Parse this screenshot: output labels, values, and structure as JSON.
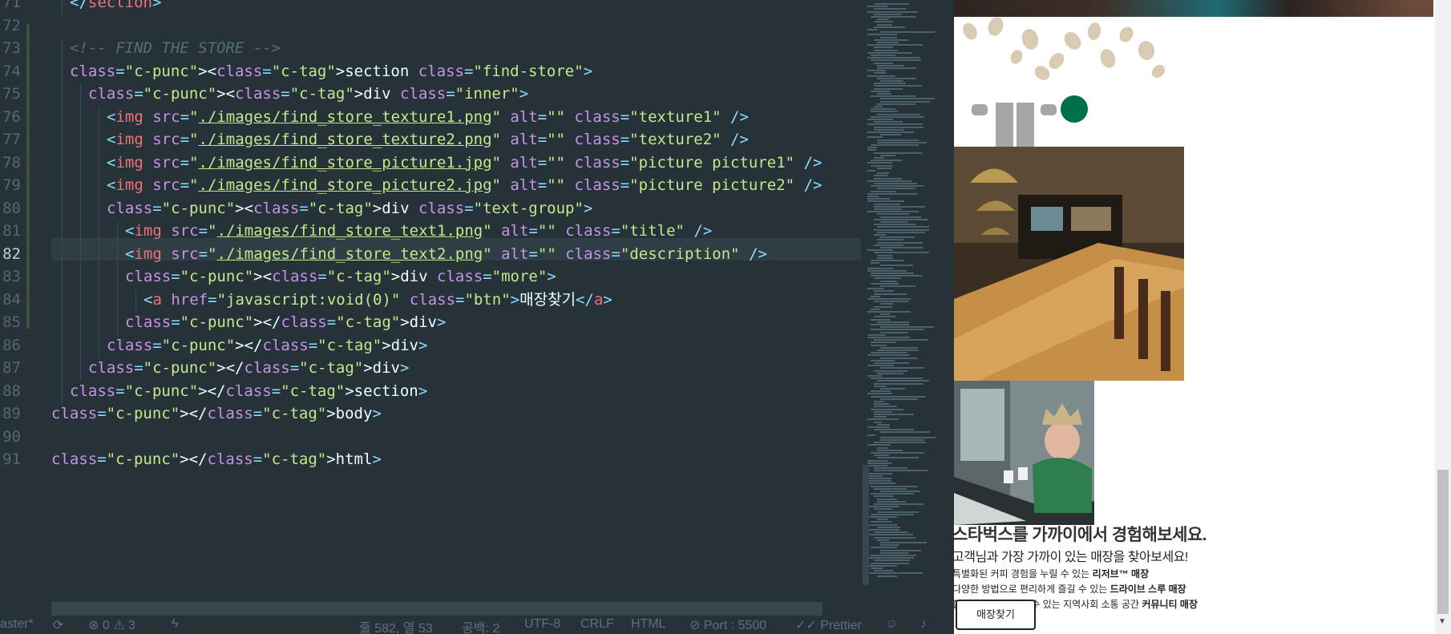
{
  "editor": {
    "line_numbers": [
      "71",
      "72",
      "73",
      "74",
      "75",
      "76",
      "77",
      "78",
      "79",
      "80",
      "81",
      "82",
      "83",
      "84",
      "85",
      "86",
      "87",
      "88",
      "89",
      "90",
      "91"
    ],
    "lines": [
      {
        "cls": "c-tag",
        "text": "</section>"
      },
      {
        "text": ""
      },
      {
        "text": "<!-- FIND THE STORE -->"
      },
      {
        "text": "<section class=\"find-store\">"
      },
      {
        "text": "<div class=\"inner\">"
      },
      {
        "path": "./images/find_store_texture1.png",
        "cls_val": "texture1"
      },
      {
        "path": "./images/find_store_texture2.png",
        "cls_val": "texture2"
      },
      {
        "path": "./images/find_store_picture1.jpg",
        "cls_val": "picture picture1"
      },
      {
        "path": "./images/find_store_picture2.jpg",
        "cls_val": "picture picture2"
      },
      {
        "text": "<div class=\"text-group\">"
      },
      {
        "path": "./images/find_store_text1.png",
        "cls_val": "title"
      },
      {
        "path": "./images/find_store_text2.png",
        "cls_val": "description"
      },
      {
        "text": "<div class=\"more\">"
      },
      {
        "href": "javascript:void(0)",
        "btn_cls": "btn",
        "label": "매장찾기"
      },
      {
        "text": "</div>"
      },
      {
        "text": "</div>"
      },
      {
        "text": "</div>"
      },
      {
        "text": "</section>"
      },
      {
        "text": "</body>"
      },
      {
        "text": ""
      },
      {
        "text": "</html>"
      }
    ],
    "statusbar": {
      "branch": "aster*",
      "errors": "0",
      "warnings": "3",
      "cursor": "줄 582, 열 53",
      "indent": "공백: 2",
      "encoding": "UTF-8",
      "eol": "CRLF",
      "language": "HTML",
      "port": "Port : 5500",
      "formatter": "Prettier"
    }
  },
  "preview": {
    "title": "스타벅스를 가까이에서 경험해보세요.",
    "subtitle": "고객님과 가장 가까이 있는 매장을 찾아보세요!",
    "items": [
      {
        "prefix": "특별화된 커피 경험을 누릴 수 있는 ",
        "bold": "리저브™ 매장"
      },
      {
        "prefix": "다양한 방법으로 편리하게 즐길 수 있는 ",
        "bold": "드라이브 스루 매장"
      },
      {
        "prefix": "함께해서 더 따뜻할 수 있는 지역사회 소통 공간 ",
        "bold": "커뮤니티 매장"
      }
    ],
    "button_label": "매장찾기"
  },
  "colors": {
    "editor_bg": "#263238",
    "tag": "#f07178",
    "attr": "#c792ea",
    "string": "#c3e88d",
    "punctuation": "#89ddff",
    "starbucks_green": "#00704a"
  }
}
